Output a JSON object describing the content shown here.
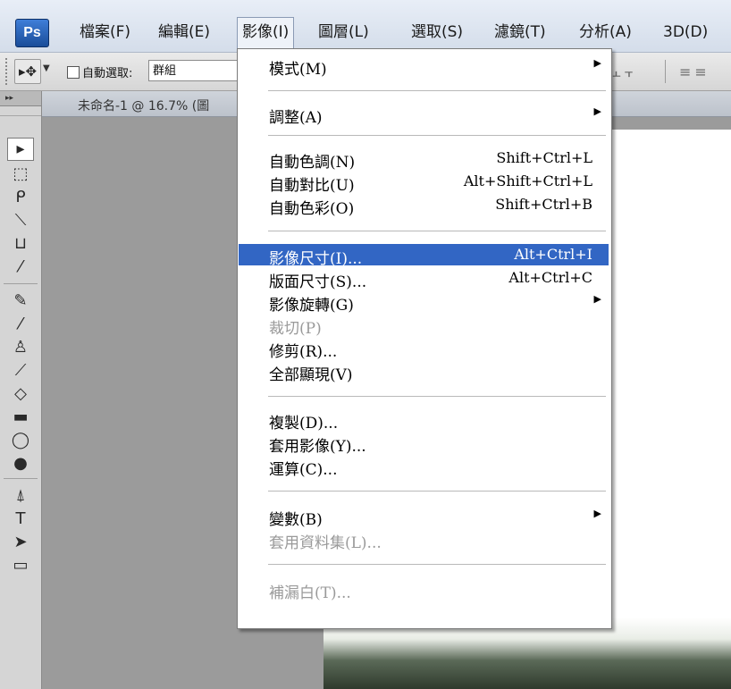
{
  "app": {
    "logo": "Ps"
  },
  "menubar": {
    "items": [
      {
        "label": "檔案(F)"
      },
      {
        "label": "編輯(E)"
      },
      {
        "label": "影像(I)"
      },
      {
        "label": "圖層(L)"
      },
      {
        "label": "選取(S)"
      },
      {
        "label": "濾鏡(T)"
      },
      {
        "label": "分析(A)"
      },
      {
        "label": "3D(D)"
      }
    ]
  },
  "options": {
    "autoselect_label": "自動選取:",
    "autoselect_value": "群組"
  },
  "document": {
    "tab_label": "未命名-1 @ 16.7% (圖"
  },
  "image_menu": {
    "items": [
      {
        "label": "模式(M)",
        "shortcut": "",
        "submenu": true
      },
      {
        "label": "調整(A)",
        "shortcut": "",
        "submenu": true
      },
      {
        "label": "自動色調(N)",
        "shortcut": "Shift+Ctrl+L"
      },
      {
        "label": "自動對比(U)",
        "shortcut": "Alt+Shift+Ctrl+L"
      },
      {
        "label": "自動色彩(O)",
        "shortcut": "Shift+Ctrl+B"
      },
      {
        "label": "影像尺寸(I)...",
        "shortcut": "Alt+Ctrl+I",
        "highlighted": true
      },
      {
        "label": "版面尺寸(S)...",
        "shortcut": "Alt+Ctrl+C"
      },
      {
        "label": "影像旋轉(G)",
        "shortcut": "",
        "submenu": true
      },
      {
        "label": "裁切(P)",
        "shortcut": "",
        "disabled": true
      },
      {
        "label": "修剪(R)...",
        "shortcut": ""
      },
      {
        "label": "全部顯現(V)",
        "shortcut": ""
      },
      {
        "label": "複製(D)...",
        "shortcut": ""
      },
      {
        "label": "套用影像(Y)...",
        "shortcut": ""
      },
      {
        "label": "運算(C)...",
        "shortcut": ""
      },
      {
        "label": "變數(B)",
        "shortcut": "",
        "submenu": true
      },
      {
        "label": "套用資料集(L)...",
        "shortcut": "",
        "disabled": true
      },
      {
        "label": "補漏白(T)...",
        "shortcut": "",
        "disabled": true
      }
    ]
  },
  "icons": {
    "tools": [
      "move-icon",
      "marquee-icon",
      "lasso-icon",
      "quick-select-icon",
      "crop-icon",
      "eyedropper-icon",
      "healing-brush-icon",
      "brush-icon",
      "clone-stamp-icon",
      "history-brush-icon",
      "eraser-icon",
      "gradient-icon",
      "blur-icon",
      "dodge-icon",
      "pen-icon",
      "type-icon",
      "path-select-icon",
      "shape-icon"
    ]
  },
  "colors": {
    "menu_highlight": "#3266c4",
    "disabled_text": "#9a9a9a"
  }
}
